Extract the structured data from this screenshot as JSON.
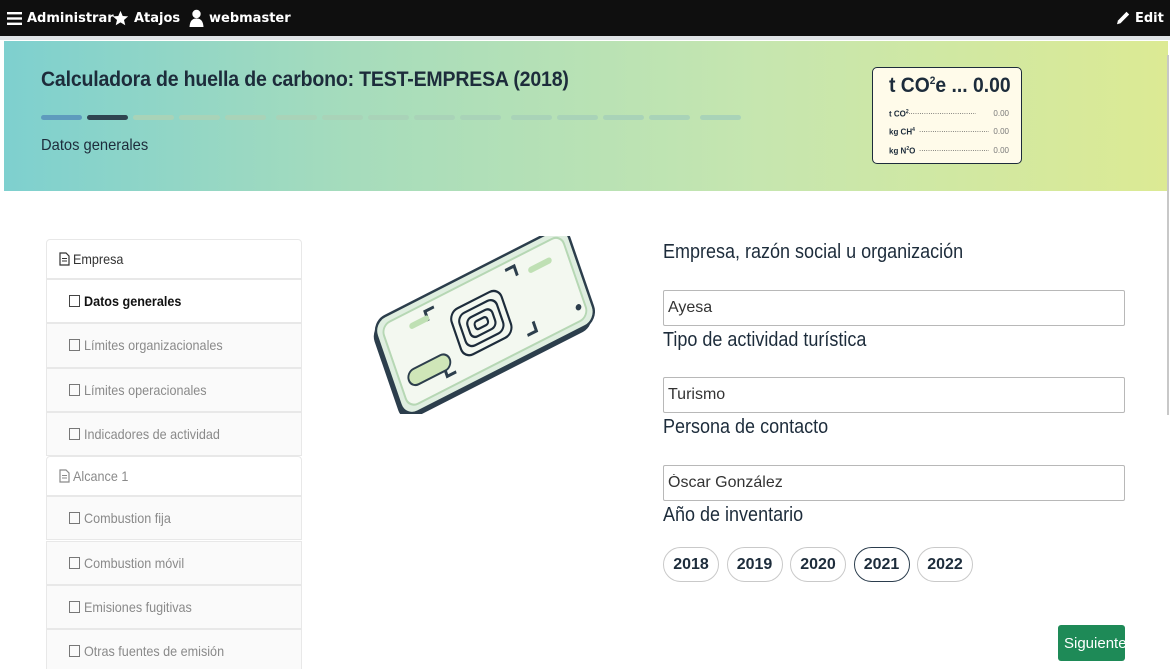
{
  "toolbar": {
    "administer": "Administrar",
    "shortcuts": "Atajos",
    "user": "webmaster",
    "edit": "Edit"
  },
  "header": {
    "title": "Calculadora de huella de carbono: TEST-EMPRESA (2018)",
    "step_label": "Datos generales",
    "progress": {
      "total_steps": 15,
      "completed": 1,
      "current": 2
    }
  },
  "emissions": {
    "total_unit": "t CO",
    "total_sup": "2",
    "total_suffix": "e ...",
    "total_value": "0.00",
    "rows": [
      {
        "label": "t CO",
        "sup": "2",
        "value": "0.00"
      },
      {
        "label": "kg CH",
        "sup": "4",
        "value": "0.00"
      },
      {
        "label": "kg N",
        "sup": "2",
        "label_suffix": "O",
        "value": "0.00"
      }
    ]
  },
  "sidebar": {
    "items": [
      {
        "label": "Empresa",
        "type": "group",
        "icon": "document-icon"
      },
      {
        "label": "Datos generales",
        "type": "sub",
        "active": true
      },
      {
        "label": "Límites organizacionales",
        "type": "sub"
      },
      {
        "label": "Límites operacionales",
        "type": "sub"
      },
      {
        "label": "Indicadores de actividad",
        "type": "sub"
      },
      {
        "label": "Alcance 1",
        "type": "group",
        "icon": "document-icon"
      },
      {
        "label": "Combustion fija",
        "type": "sub"
      },
      {
        "label": "Combustion móvil",
        "type": "sub"
      },
      {
        "label": "Emisiones fugitivas",
        "type": "sub"
      },
      {
        "label": "Otras fuentes de emisión",
        "type": "sub"
      }
    ]
  },
  "form": {
    "company_label": "Empresa, razón social u organización",
    "company_value": "Ayesa",
    "activity_label": "Tipo de actividad turística",
    "activity_value": "Turismo",
    "contact_label": "Persona de contacto",
    "contact_value": "Óscar González",
    "year_label": "Año de inventario",
    "years": [
      "2018",
      "2019",
      "2020",
      "2021",
      "2022"
    ],
    "selected_year": "2021",
    "next_label": "Siguiente"
  },
  "colors": {
    "toolbar": "#0f0f0f",
    "banner_start": "#7ed0cf",
    "banner_end": "#dcea94",
    "accent_dark": "#1d2c3b",
    "primary_button": "#1e8a57"
  }
}
